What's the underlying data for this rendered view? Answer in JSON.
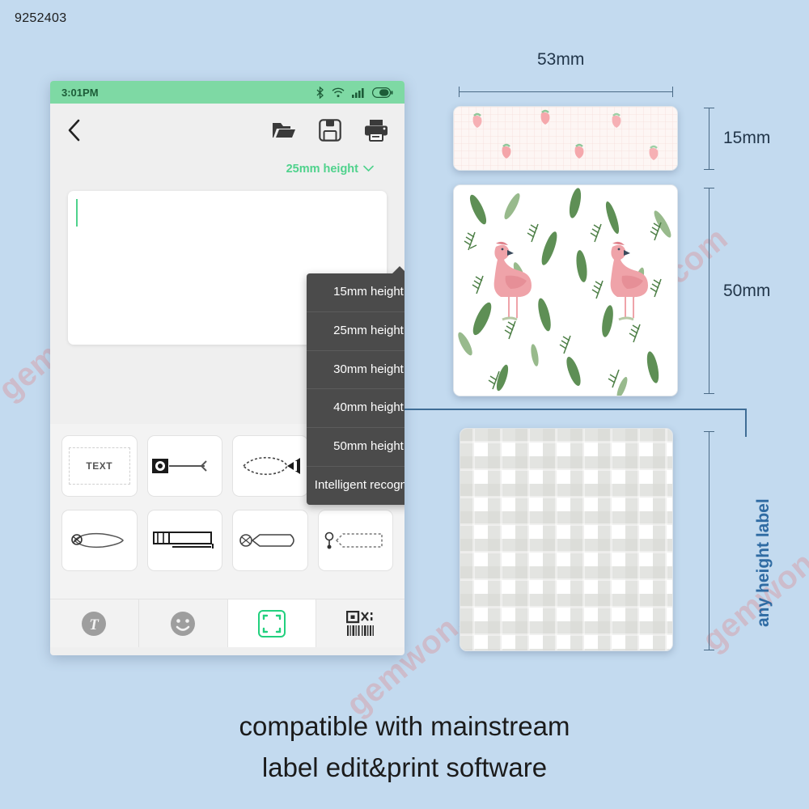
{
  "product_code": "9252403",
  "watermark": {
    "text": "gemwon.com"
  },
  "phone": {
    "status_bar": {
      "time": "3:01PM",
      "icons": [
        "bluetooth-icon",
        "wifi-icon",
        "signal-icon",
        "battery-icon"
      ]
    },
    "toolbar": {
      "back_label": "back-icon",
      "actions": [
        {
          "name": "open-folder-icon",
          "label": "Open"
        },
        {
          "name": "save-icon",
          "label": "Save"
        },
        {
          "name": "print-icon",
          "label": "Print"
        }
      ]
    },
    "height_selector": {
      "selected": "25mm height",
      "chevron": "chevron-down-icon",
      "accent_color": "#4fd28c"
    },
    "dropdown": {
      "open": true,
      "items": [
        "15mm height",
        "25mm height",
        "30mm height",
        "40mm height",
        "50mm height",
        "Intelligent recognize"
      ]
    },
    "canvas": {
      "cursor_visible": true
    },
    "templates": [
      {
        "name": "template-text",
        "label": "TEXT",
        "kind": "text"
      },
      {
        "name": "template-tag-2",
        "label": "",
        "kind": "tag-round"
      },
      {
        "name": "template-tag-3",
        "label": "",
        "kind": "tag-dashed"
      },
      {
        "name": "template-tag-4",
        "label": "",
        "kind": "tag-flag"
      },
      {
        "name": "template-tag-5",
        "label": "",
        "kind": "tag-oval"
      },
      {
        "name": "template-tag-6",
        "label": "",
        "kind": "tag-box"
      },
      {
        "name": "template-tag-7",
        "label": "",
        "kind": "tag-pill"
      },
      {
        "name": "template-tag-8",
        "label": "",
        "kind": "tag-hook"
      }
    ],
    "tabs": [
      {
        "name": "tab-text",
        "icon": "text-tool-icon",
        "active": false
      },
      {
        "name": "tab-emoji",
        "icon": "emoji-icon",
        "active": false
      },
      {
        "name": "tab-frame",
        "icon": "frame-crop-icon",
        "active": true
      },
      {
        "name": "tab-barcode",
        "icon": "barcode-qr-icon",
        "active": false
      }
    ]
  },
  "labels": {
    "width_dimension": "53mm",
    "strawberry": {
      "height_dimension": "15mm",
      "pattern": "pink-grid-strawberry"
    },
    "flamingo": {
      "height_dimension": "50mm",
      "pattern": "tropical-flamingo"
    },
    "plaid": {
      "height_dimension": "any height label",
      "pattern": "grey-gingham"
    }
  },
  "caption": {
    "line1": "compatible with mainstream",
    "line2": "label edit&print software"
  },
  "colors": {
    "background": "#c3daef",
    "accent_green": "#4fd28c",
    "status_green": "#7ed9a4",
    "dimension_blue": "#4a6a86",
    "connector_blue": "#3f6d96"
  }
}
